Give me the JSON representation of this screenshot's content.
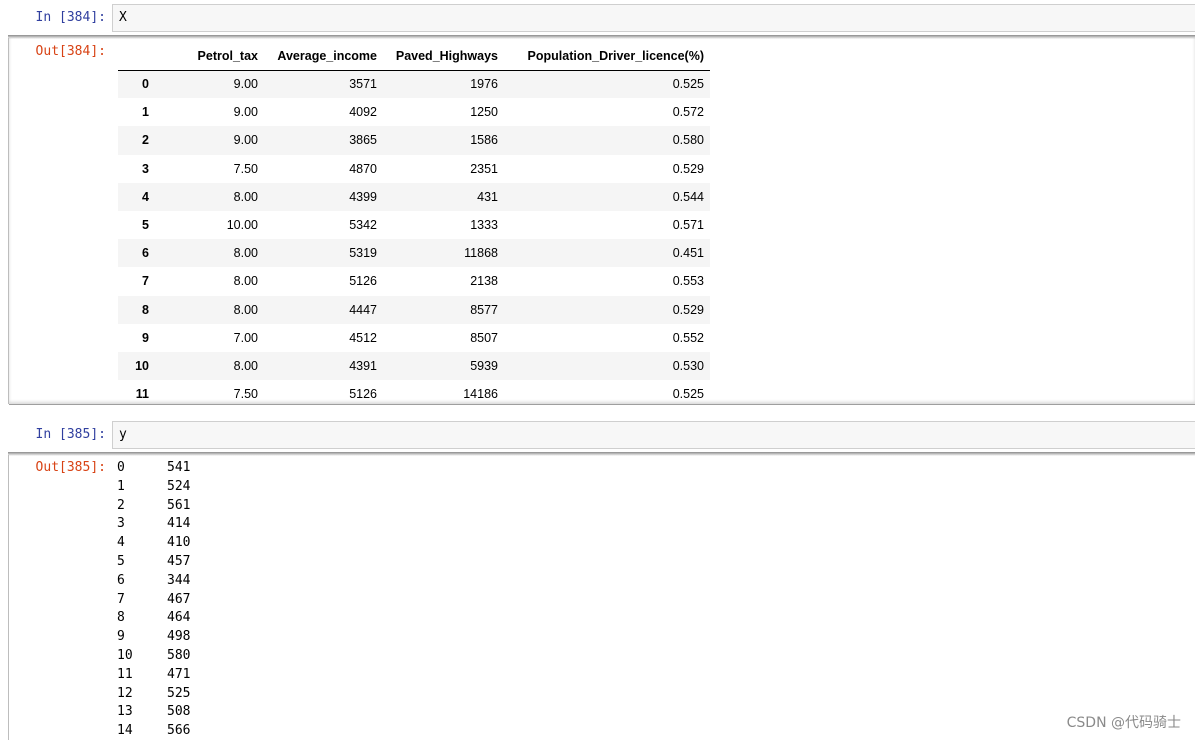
{
  "cell384": {
    "in_prompt": "In [384]:",
    "code": "X",
    "out_prompt": "Out[384]:",
    "columns": [
      "",
      "Petrol_tax",
      "Average_income",
      "Paved_Highways",
      "Population_Driver_licence(%)"
    ],
    "rows": [
      [
        "0",
        "9.00",
        "3571",
        "1976",
        "0.525"
      ],
      [
        "1",
        "9.00",
        "4092",
        "1250",
        "0.572"
      ],
      [
        "2",
        "9.00",
        "3865",
        "1586",
        "0.580"
      ],
      [
        "3",
        "7.50",
        "4870",
        "2351",
        "0.529"
      ],
      [
        "4",
        "8.00",
        "4399",
        "431",
        "0.544"
      ],
      [
        "5",
        "10.00",
        "5342",
        "1333",
        "0.571"
      ],
      [
        "6",
        "8.00",
        "5319",
        "11868",
        "0.451"
      ],
      [
        "7",
        "8.00",
        "5126",
        "2138",
        "0.553"
      ],
      [
        "8",
        "8.00",
        "4447",
        "8577",
        "0.529"
      ],
      [
        "9",
        "7.00",
        "4512",
        "8507",
        "0.552"
      ],
      [
        "10",
        "8.00",
        "4391",
        "5939",
        "0.530"
      ],
      [
        "11",
        "7.50",
        "5126",
        "14186",
        "0.525"
      ]
    ]
  },
  "cell385": {
    "in_prompt": "In [385]:",
    "code": "y",
    "out_prompt": "Out[385]:",
    "series": [
      [
        "0",
        "541"
      ],
      [
        "1",
        "524"
      ],
      [
        "2",
        "561"
      ],
      [
        "3",
        "414"
      ],
      [
        "4",
        "410"
      ],
      [
        "5",
        "457"
      ],
      [
        "6",
        "344"
      ],
      [
        "7",
        "467"
      ],
      [
        "8",
        "464"
      ],
      [
        "9",
        "498"
      ],
      [
        "10",
        "580"
      ],
      [
        "11",
        "471"
      ],
      [
        "12",
        "525"
      ],
      [
        "13",
        "508"
      ],
      [
        "14",
        "566"
      ]
    ]
  },
  "watermark": "CSDN @代码骑士",
  "colors": {
    "in_prompt": "#303f9f",
    "out_prompt": "#d84315",
    "input_bg": "#f7f7f7"
  }
}
